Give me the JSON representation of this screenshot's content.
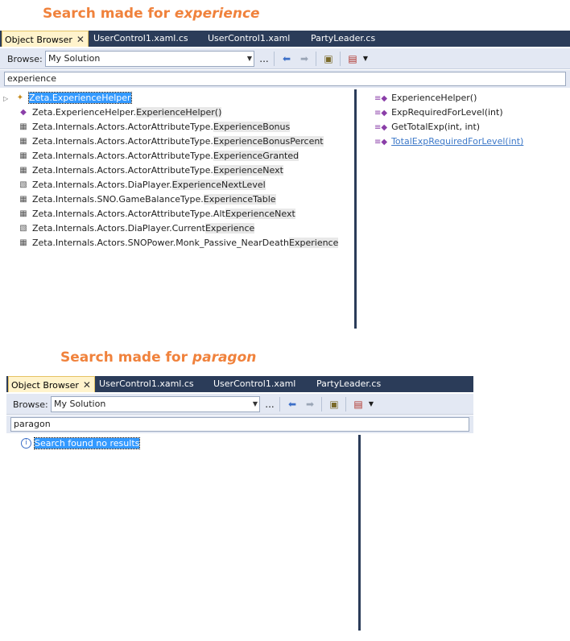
{
  "caption1": {
    "prefix": "Search made for ",
    "term": "experience"
  },
  "caption2": {
    "prefix": "Search made for ",
    "term": "paragon"
  },
  "tabs": [
    "Object Browser",
    "UserControl1.xaml.cs",
    "UserControl1.xaml",
    "PartyLeader.cs"
  ],
  "close_symbol": "✕",
  "browse_label": "Browse:",
  "browse_value": "My Solution",
  "ellipsis": "...",
  "panel1": {
    "search": "experience",
    "results": [
      {
        "pre": "Zeta.ExperienceHelper",
        "match": "",
        "post": "",
        "icon": "class-icon",
        "selected": true
      },
      {
        "pre": "Zeta.ExperienceHelper.",
        "match": "Experience",
        "post": "Helper()",
        "icon": "method-icon"
      },
      {
        "pre": "Zeta.Internals.Actors.ActorAttributeType.",
        "match": "Experience",
        "post": "Bonus",
        "icon": "enum-item-icon"
      },
      {
        "pre": "Zeta.Internals.Actors.ActorAttributeType.",
        "match": "Experience",
        "post": "BonusPercent",
        "icon": "enum-item-icon"
      },
      {
        "pre": "Zeta.Internals.Actors.ActorAttributeType.",
        "match": "Experience",
        "post": "Granted",
        "icon": "enum-item-icon"
      },
      {
        "pre": "Zeta.Internals.Actors.ActorAttributeType.",
        "match": "Experience",
        "post": "Next",
        "icon": "enum-item-icon"
      },
      {
        "pre": "Zeta.Internals.Actors.DiaPlayer.",
        "match": "Experience",
        "post": "NextLevel",
        "icon": "property-icon"
      },
      {
        "pre": "Zeta.Internals.SNO.GameBalanceType.",
        "match": "Experience",
        "post": "Table",
        "icon": "enum-item-icon"
      },
      {
        "pre": "Zeta.Internals.Actors.ActorAttributeType.Alt",
        "match": "Experience",
        "post": "Next",
        "icon": "enum-item-icon"
      },
      {
        "pre": "Zeta.Internals.Actors.DiaPlayer.Current",
        "match": "Experience",
        "post": "",
        "icon": "property-icon"
      },
      {
        "pre": "Zeta.Internals.Actors.SNOPower.Monk_Passive_NearDeath",
        "match": "Experience",
        "post": "",
        "icon": "enum-item-icon"
      }
    ],
    "members": [
      "ExperienceHelper()",
      "ExpRequiredForLevel(int)",
      "GetTotalExp(int, int)",
      "TotalExpRequiredForLevel(int)"
    ]
  },
  "panel2": {
    "search": "paragon",
    "no_results": "Search found no results"
  },
  "colors": {
    "tabbar": "#2b3c59",
    "caption": "#f0823c",
    "selection": "#3399ff"
  }
}
